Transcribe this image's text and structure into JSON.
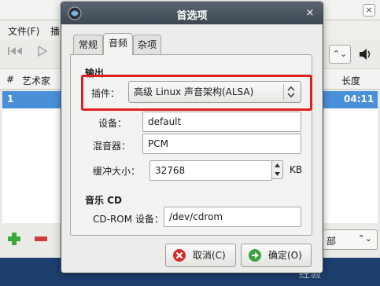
{
  "background_window": {
    "menu": [
      "文件(F)",
      "播"
    ],
    "close_glyph": "×",
    "toolbar": {
      "combo_glyph": "⌃⌄"
    },
    "columns": {
      "num": "#",
      "artist": "艺术家",
      "length": "长度"
    },
    "selected_row": {
      "num": "1",
      "length": "04:11"
    },
    "bottom_combo": {
      "text": "部",
      "glyph": "⌃⌄"
    },
    "watermark": "经验"
  },
  "dialog": {
    "title": "首选项",
    "close_glyph": "×",
    "tabs": [
      "常规",
      "音频",
      "杂项"
    ],
    "active_tab": 1,
    "output_section": "输出",
    "plugin_label": "插件：",
    "plugin_value": "高级 Linux 声音架构(ALSA)",
    "device_label": "设备：",
    "device_value": "default",
    "mixer_label": "混音器：",
    "mixer_value": "PCM",
    "buffer_label": "缓冲大小：",
    "buffer_value": "32768",
    "buffer_unit": "KB",
    "cd_section": "音乐 CD",
    "cdrom_label": "CD-ROM 设备：",
    "cdrom_value": "/dev/cdrom",
    "cancel_label": "取消(C)",
    "ok_label": "确定(O)"
  },
  "colors": {
    "selection": "#4a90d9",
    "highlight_box": "#e02020",
    "titlebar": "#3e4752"
  }
}
